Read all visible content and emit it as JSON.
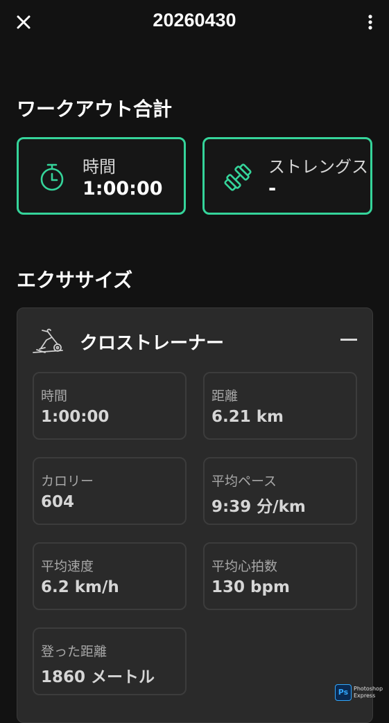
{
  "header": {
    "title": "20260430",
    "close_icon": "close-icon",
    "more_icon": "more-vertical-icon"
  },
  "workout_summary": {
    "section_title": "ワークアウト合計",
    "cards": [
      {
        "icon": "stopwatch-icon",
        "label": "時間",
        "value": "1:00:00"
      },
      {
        "icon": "dumbbell-icon",
        "label": "ストレングス",
        "value": "-"
      }
    ]
  },
  "exercises": {
    "section_title": "エクササイズ",
    "items": [
      {
        "icon": "cross-trainer-icon",
        "name": "クロストレーナー",
        "collapse_icon": "collapse-icon",
        "stats": [
          {
            "label": "時間",
            "value": "1:00:00"
          },
          {
            "label": "距離",
            "value": "6.21 km"
          },
          {
            "label": "カロリー",
            "value": "604"
          },
          {
            "label": "平均ペース",
            "value": "9:39 分/km"
          },
          {
            "label": "平均速度",
            "value": "6.2 km/h"
          },
          {
            "label": "平均心拍数",
            "value": "130 bpm"
          },
          {
            "label": "登った距離",
            "value": "1860 メートル"
          }
        ]
      }
    ]
  },
  "watermark": {
    "logo_text": "Ps",
    "line1": "Photoshop",
    "line2": "Express"
  },
  "colors": {
    "background": "#121212",
    "accent": "#35d49a",
    "panel": "#2a2a2a"
  }
}
